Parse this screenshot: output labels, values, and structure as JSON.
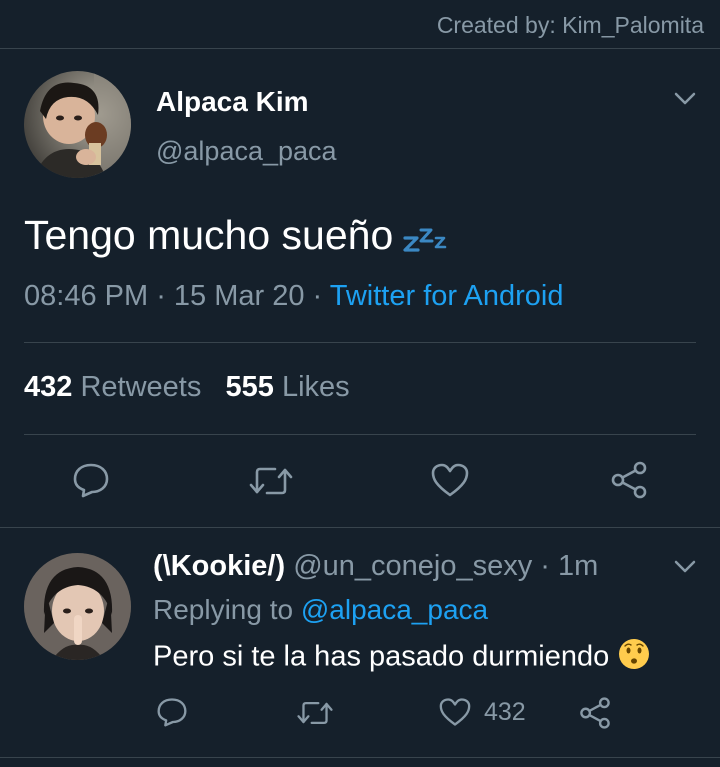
{
  "credit": "Created by: Kim_Palomita",
  "tweet": {
    "name": "Alpaca Kim",
    "handle": "@alpaca_paca",
    "text": "Tengo mucho sueño",
    "time": "08:46 PM",
    "date": "15 Mar 20",
    "client": "Twitter for Android",
    "retweets": "432",
    "retweets_label": "Retweets",
    "likes": "555",
    "likes_label": "Likes"
  },
  "reply": {
    "name": "(\\Kookie/)",
    "handle": "@un_conejo_sexy",
    "age": "1m",
    "replying_prefix": "Replying to",
    "replying_to": "@alpaca_paca",
    "text": "Pero si te la has pasado durmiendo",
    "like_count": "432"
  },
  "colors": {
    "background": "#15202b",
    "accent": "#1da1f2",
    "secondary_text": "#8899a6",
    "divider": "#38444d"
  },
  "icons": {
    "reply": "speech-bubble-icon",
    "retweet": "retweet-icon",
    "like": "heart-icon",
    "share": "share-icon",
    "menu": "chevron-down-icon"
  }
}
